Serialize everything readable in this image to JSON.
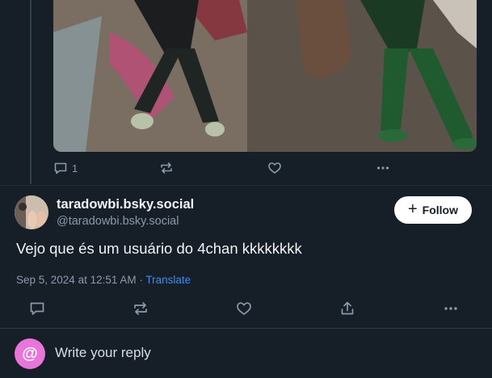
{
  "parent_post": {
    "reply_count": "1",
    "icons": [
      "reply-icon",
      "repost-icon",
      "like-icon",
      "more-icon"
    ]
  },
  "post": {
    "display_name": "taradowbi.bsky.social",
    "handle": "@taradowbi.bsky.social",
    "follow_label": "Follow",
    "follow_icon": "+",
    "text": "Vejo que és um usuário do 4chan kkkkkkkk",
    "timestamp": "Sep 5, 2024 at 12:51 AM",
    "separator": "·",
    "translate_label": "Translate",
    "icons": [
      "reply-icon",
      "repost-icon",
      "like-icon",
      "share-icon",
      "more-icon"
    ]
  },
  "reply_bar": {
    "avatar_glyph": "@",
    "placeholder": "Write your reply"
  },
  "colors": {
    "background": "#161e27",
    "muted_text": "#8a9aab",
    "link": "#3d8bf2",
    "reply_avatar": "#e776d8"
  }
}
